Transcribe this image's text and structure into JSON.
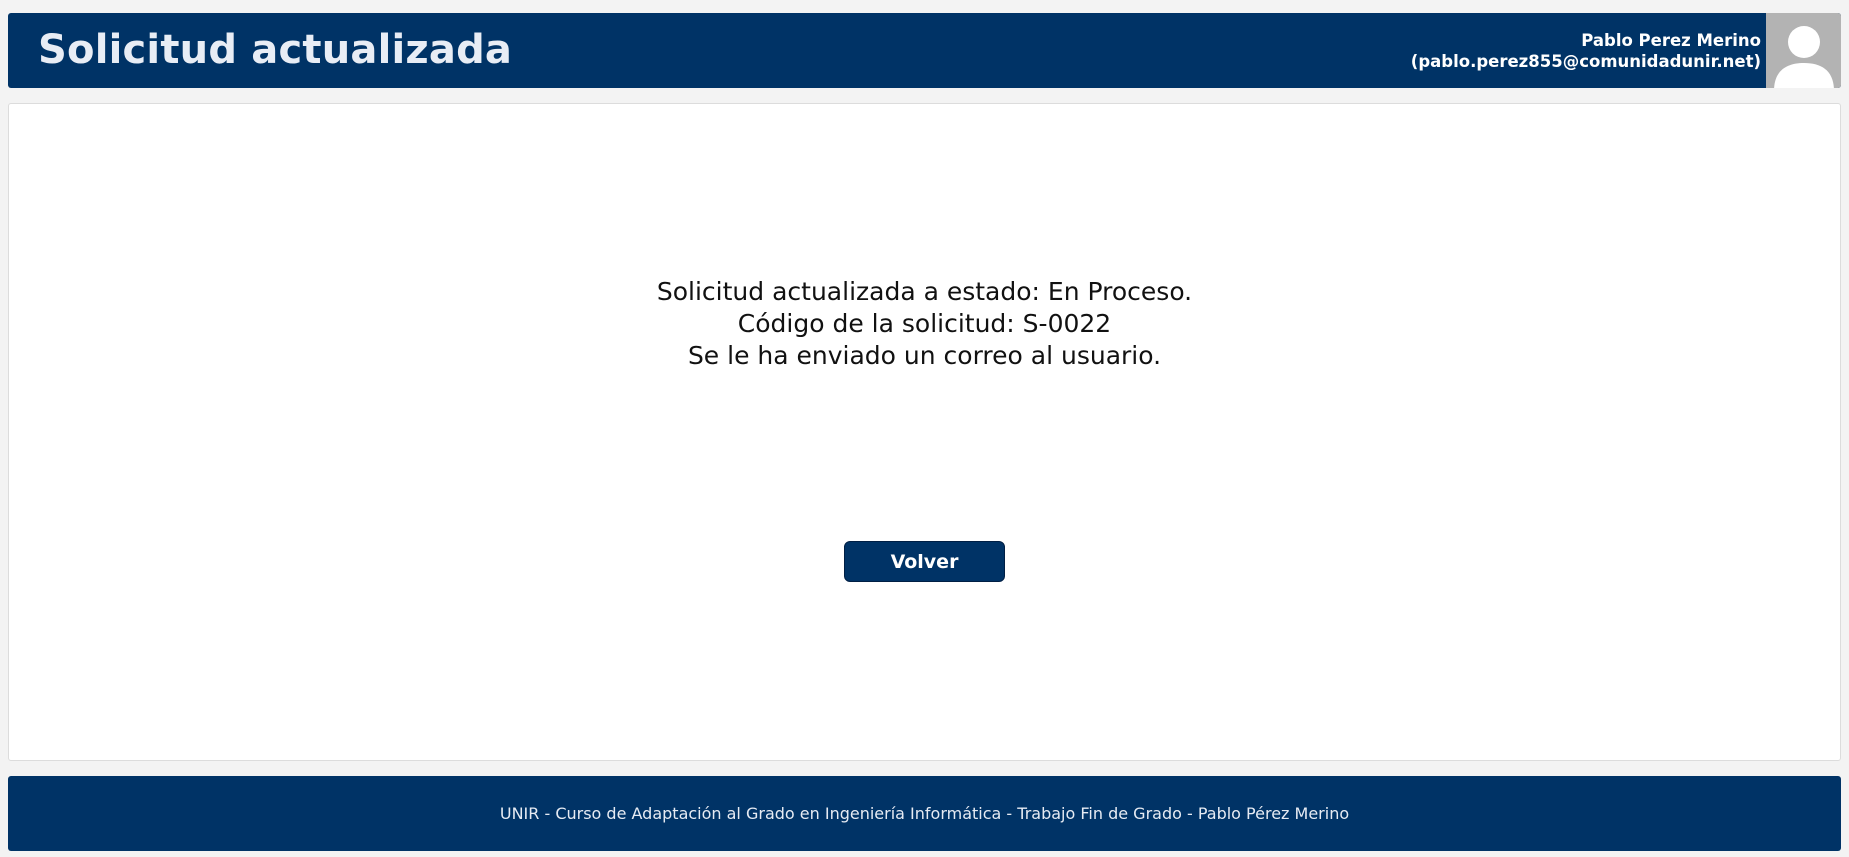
{
  "header": {
    "title": "Solicitud actualizada",
    "user_name": "Pablo Perez Merino",
    "user_email": "(pablo.perez855@comunidadunir.net)",
    "avatar_icon": "user-silhouette-icon"
  },
  "main": {
    "message_lines": [
      "Solicitud actualizada a estado: En Proceso.",
      "Código de la solicitud: S-0022",
      "Se le ha enviado un correo al usuario."
    ],
    "back_button_label": "Volver"
  },
  "footer": {
    "text": "UNIR - Curso de Adaptación al Grado en Ingeniería Informática - Trabajo Fin de Grado - Pablo Pérez Merino"
  },
  "colors": {
    "primary": "#003366",
    "background": "#f3f3f3",
    "card": "#ffffff",
    "avatar_bg": "#b3b3b3"
  }
}
